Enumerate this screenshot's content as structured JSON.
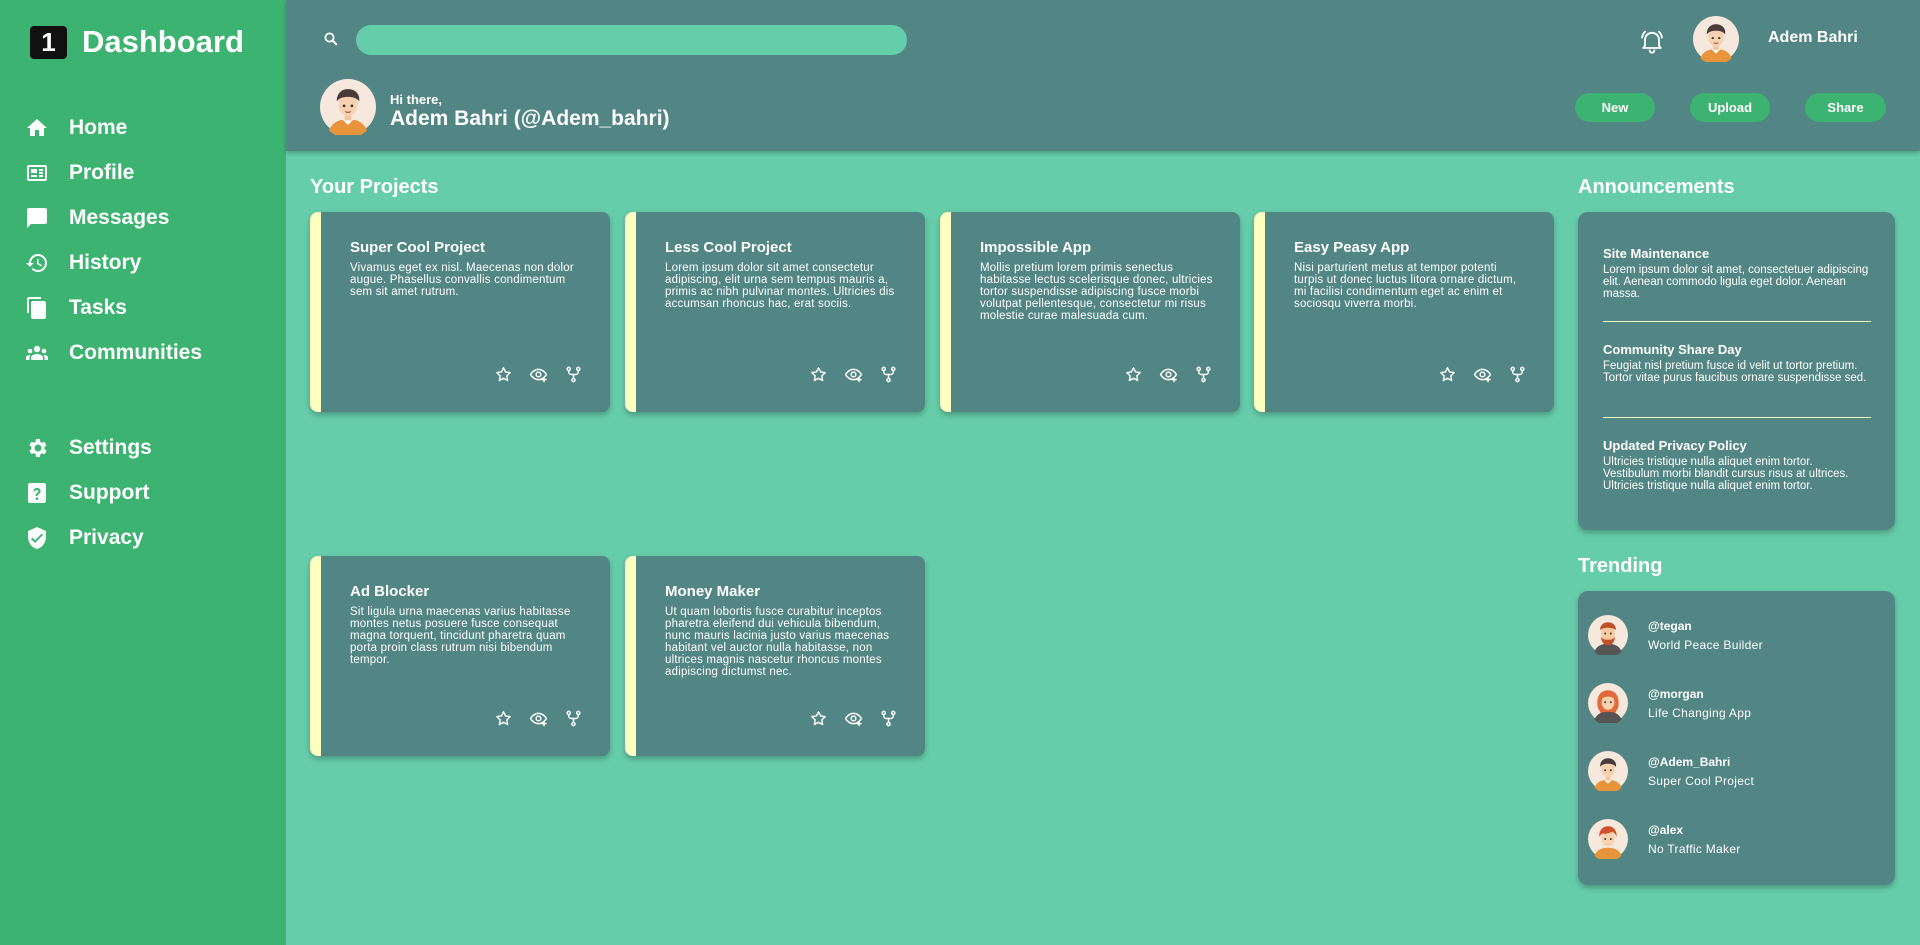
{
  "brand": {
    "logo_text": "1",
    "title": "Dashboard"
  },
  "nav": [
    {
      "label": "Home",
      "icon": "home-icon"
    },
    {
      "label": "Profile",
      "icon": "profile-card-icon"
    },
    {
      "label": "Messages",
      "icon": "chat-icon"
    },
    {
      "label": "History",
      "icon": "history-icon"
    },
    {
      "label": "Tasks",
      "icon": "file-icon"
    },
    {
      "label": "Communities",
      "icon": "people-icon"
    }
  ],
  "nav_secondary": [
    {
      "label": "Settings",
      "icon": "gear-icon"
    },
    {
      "label": "Support",
      "icon": "help-icon"
    },
    {
      "label": "Privacy",
      "icon": "shield-icon"
    }
  ],
  "header": {
    "search_placeholder": "",
    "user_name": "Adem Bahri",
    "greeting_small": "Hi there,",
    "greeting_name": "Adem Bahri (@Adem_bahri)",
    "buttons": {
      "new": "New",
      "upload": "Upload",
      "share": "Share"
    }
  },
  "projects_title": "Your Projects",
  "projects": [
    {
      "title": "Super Cool Project",
      "desc": "Vivamus eget ex nisl. Maecenas non dolor augue. Phasellus convallis condimentum sem sit amet rutrum."
    },
    {
      "title": "Less Cool Project",
      "desc": "Lorem ipsum dolor sit amet consectetur adipiscing, elit urna sem tempus mauris a, primis ac nibh pulvinar montes. Ultricies dis accumsan rhoncus hac, erat sociis."
    },
    {
      "title": "Impossible App",
      "desc": "Mollis pretium lorem primis senectus habitasse lectus scelerisque donec, ultricies tortor suspendisse adipiscing fusce morbi volutpat pellentesque, consectetur mi risus molestie curae malesuada cum."
    },
    {
      "title": "Easy Peasy App",
      "desc": "Nisi parturient metus at tempor potenti turpis ut donec luctus litora ornare dictum, mi facilisi condimentum eget ac enim et sociosqu viverra morbi."
    },
    {
      "title": "Ad Blocker",
      "desc": "Sit ligula urna maecenas varius habitasse montes netus posuere fusce consequat magna torquent, tincidunt pharetra quam porta proin class rutrum nisi bibendum tempor."
    },
    {
      "title": "Money Maker",
      "desc": "Ut quam lobortis fusce curabitur inceptos pharetra eleifend dui vehicula bibendum, nunc mauris lacinia justo varius maecenas habitant vel auctor nulla habitasse, non ultrices magnis nascetur rhoncus montes adipiscing dictumst nec."
    }
  ],
  "announcements_title": "Announcements",
  "announcements": [
    {
      "title": "Site Maintenance",
      "text": "Lorem ipsum dolor sit amet, consectetuer adipiscing elit. Aenean commodo ligula eget dolor. Aenean massa."
    },
    {
      "title": "Community Share Day",
      "text": "Feugiat nisl pretium fusce id velit ut tortor pretium. Tortor vitae purus faucibus ornare suspendisse sed."
    },
    {
      "title": "Updated Privacy Policy",
      "text": "Ultricies tristique nulla aliquet enim tortor. Vestibulum morbi blandit cursus risus at ultrices. Ultricies tristique nulla aliquet enim tortor."
    }
  ],
  "trending_title": "Trending",
  "trending": [
    {
      "handle": "@tegan",
      "project": "World Peace Builder"
    },
    {
      "handle": "@morgan",
      "project": "Life Changing App"
    },
    {
      "handle": "@Adem_Bahri",
      "project": "Super Cool Project"
    },
    {
      "handle": "@alex",
      "project": "No Traffic Maker"
    }
  ],
  "colors": {
    "sidebar": "#3cb371",
    "header": "#528684",
    "background": "#66cdaa",
    "card_accent": "#ffffc0"
  }
}
